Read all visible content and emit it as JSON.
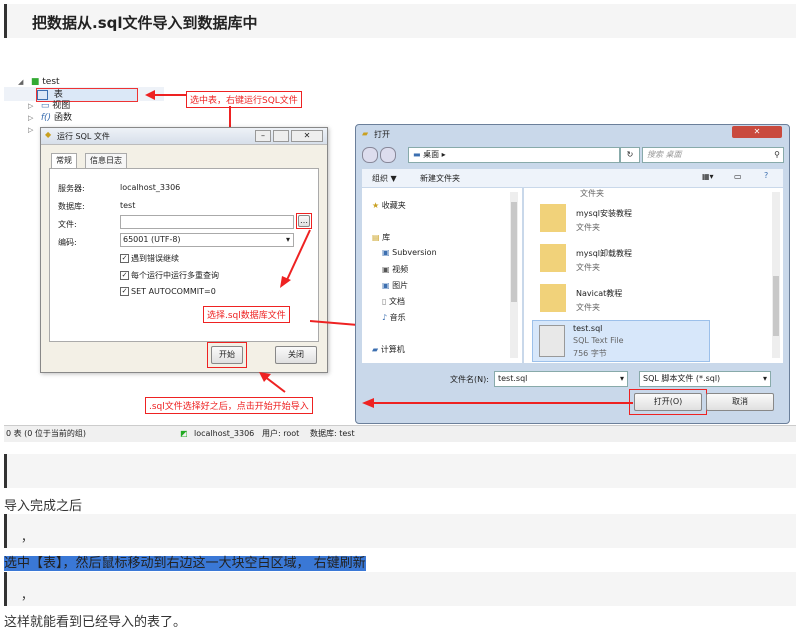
{
  "heading": "把数据从.sql文件导入到数据库中",
  "tree": {
    "db": "test",
    "items": [
      "表",
      "视图",
      "函数"
    ]
  },
  "annotations": {
    "select_table": "选中表，右键运行SQL文件",
    "choose_file": "选择.sql数据库文件",
    "after_choose": ".sql文件选择好之后，点击开始开始导入"
  },
  "run_dialog": {
    "title": "运行 SQL 文件",
    "tabs": [
      "常规",
      "信息日志"
    ],
    "server_label": "服务器:",
    "server_value": "localhost_3306",
    "db_label": "数据库:",
    "db_value": "test",
    "file_label": "文件:",
    "file_value": "",
    "encoding_label": "编码:",
    "encoding_value": "65001 (UTF-8)",
    "checks": [
      "遇到错误继续",
      "每个运行中运行多重查询",
      "SET AUTOCOMMIT=0"
    ],
    "start_button": "开始",
    "close_button": "关闭"
  },
  "open_dialog": {
    "title": "打开",
    "location": "桌面",
    "search_placeholder": "搜索 桌面",
    "organize": "组织 ▼",
    "new_folder": "新建文件夹",
    "nav": [
      "收藏夹",
      "库",
      "Subversion",
      "视频",
      "图片",
      "文档",
      "音乐",
      "计算机"
    ],
    "files": [
      {
        "name": "mysql安装教程",
        "type": "文件夹"
      },
      {
        "name": "mysql卸载教程",
        "type": "文件夹"
      },
      {
        "name": "Navicat教程",
        "type": "文件夹"
      },
      {
        "name": "test.sql",
        "type": "SQL Text File",
        "size": "756 字节"
      }
    ],
    "top_partial": "文件夹",
    "filename_label": "文件名(N):",
    "filename_value": "test.sql",
    "filter": "SQL 脚本文件 (*.sql)",
    "open_button": "打开(O)",
    "cancel_button": "取消"
  },
  "status": {
    "left": "0 表 (0 位于当前的组)",
    "conn": "localhost_3306",
    "user": "用户: root",
    "db": "数据库: test"
  },
  "blocks": {
    "comma1": "，",
    "comma2": "，",
    "after_import": "导入完成之后",
    "instruction": "选中【表】，然后鼠标移动到右边这一大块空白区域， 右键刷新",
    "final": "这样就能看到已经导入的表了。"
  }
}
